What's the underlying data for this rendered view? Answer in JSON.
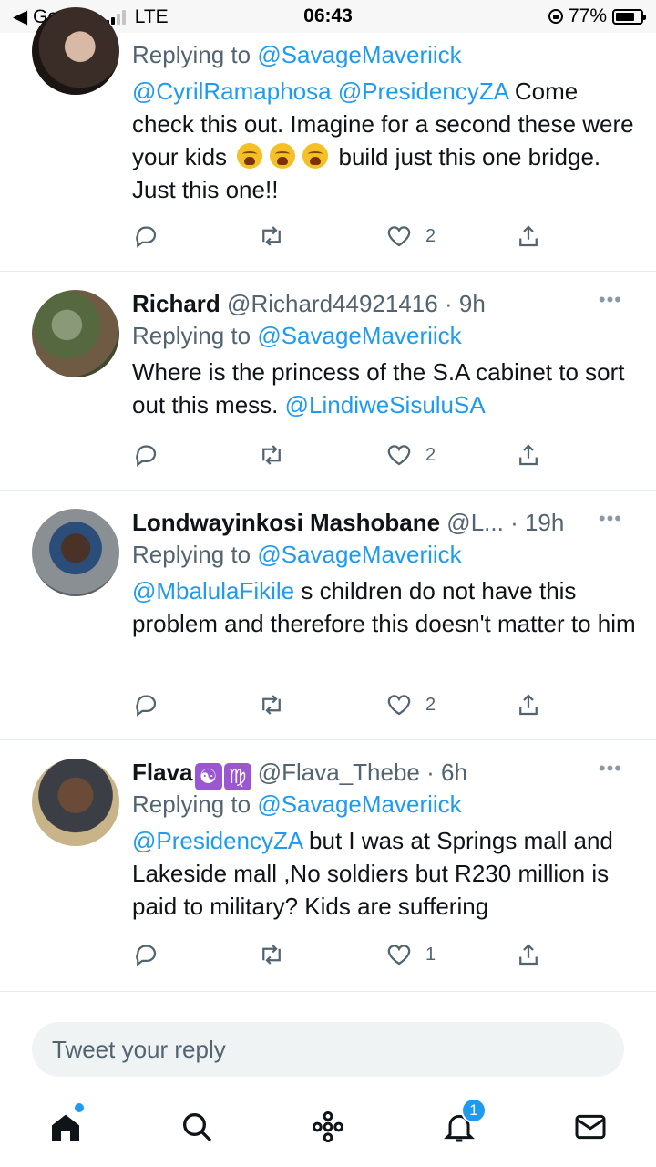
{
  "status_bar": {
    "back_label": "◀ Google",
    "network": "LTE",
    "time": "06:43",
    "battery": "77%"
  },
  "tweets": [
    {
      "replying_prefix": "Replying to",
      "replying_to": "@SavageMaveriick",
      "mentions": [
        "@CyrilRamaphosa",
        "@PresidencyZA"
      ],
      "text_a": "Come check this out. Imagine for a second these were your kids",
      "text_b": "build just this one bridge. Just this one!!",
      "likes": "2"
    },
    {
      "name": "Richard",
      "handle": "@Richard44921416",
      "separator": "·",
      "time": "9h",
      "replying_prefix": "Replying to",
      "replying_to": "@SavageMaveriick",
      "text": "Where is the princess of the S.A cabinet to sort out this mess.",
      "mention_end": "@LindiweSisuluSA",
      "likes": "2"
    },
    {
      "name": "Londwayinkosi Mashobane",
      "handle": "@L...",
      "separator": "·",
      "time": "19h",
      "replying_prefix": "Replying to",
      "replying_to": "@SavageMaveriick",
      "mention_start": "@MbalulaFikile",
      "text": "s children do not have this problem and therefore this doesn't matter to him",
      "likes": "2"
    },
    {
      "name": "Flava",
      "zodiac_a": "☯",
      "zodiac_b": "♍",
      "handle": "@Flava_Thebe",
      "separator": "·",
      "time": "6h",
      "replying_prefix": "Replying to",
      "replying_to": "@SavageMaveriick",
      "mention_start": "@PresidencyZA",
      "text": "but I was at  Springs mall and Lakeside mall ,No soldiers but R230 million is paid to military? Kids are suffering",
      "likes": "1"
    }
  ],
  "more_icon": "•••",
  "reply_placeholder": "Tweet your reply",
  "nav": {
    "notifications_badge": "1",
    "icons": [
      "home-icon",
      "search-icon",
      "spaces-icon",
      "notifications-icon",
      "messages-icon"
    ]
  },
  "colors": {
    "link": "#1d9bf0",
    "secondary": "#536471",
    "accent_badge": "#1d9bf0"
  }
}
